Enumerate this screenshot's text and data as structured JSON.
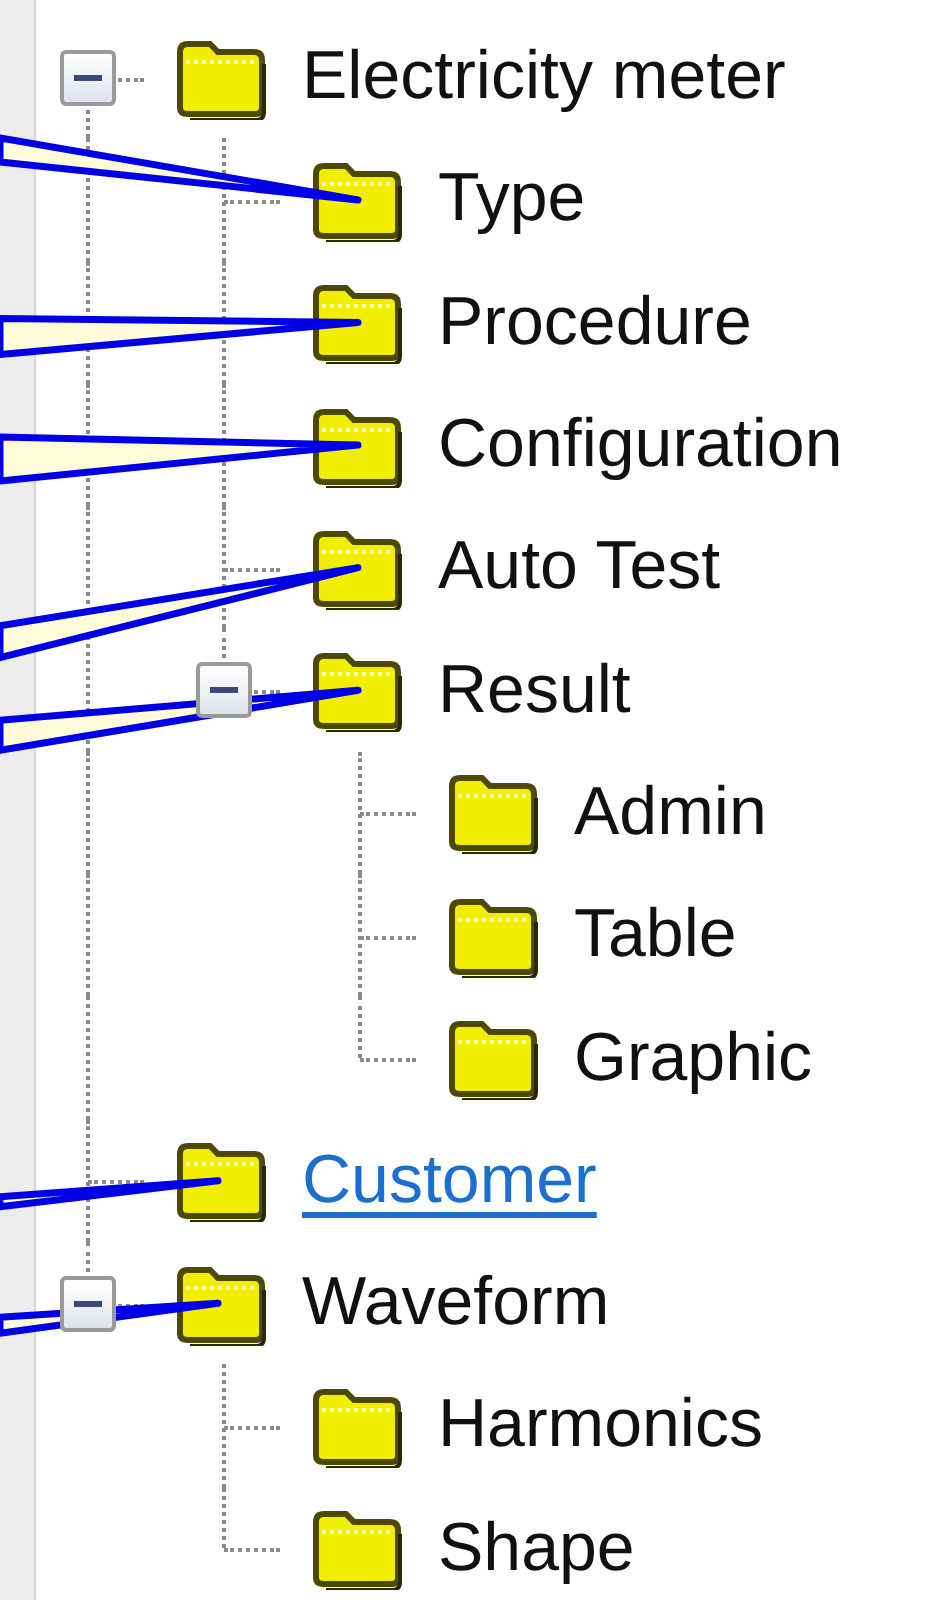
{
  "tree": [
    {
      "label": "Electricity meter",
      "expanded": true,
      "hovered": false,
      "callout": false,
      "children": [
        {
          "label": "Type",
          "hovered": false,
          "callout": true
        },
        {
          "label": "Procedure",
          "hovered": false,
          "callout": true
        },
        {
          "label": "Configuration",
          "hovered": false,
          "callout": true
        },
        {
          "label": "Auto Test",
          "hovered": false,
          "callout": true
        },
        {
          "label": "Result",
          "expanded": true,
          "hovered": false,
          "callout": true,
          "children": [
            {
              "label": "Admin",
              "hovered": false,
              "callout": false
            },
            {
              "label": "Table",
              "hovered": false,
              "callout": false
            },
            {
              "label": "Graphic",
              "hovered": false,
              "callout": false
            }
          ]
        }
      ]
    },
    {
      "label": "Customer",
      "hovered": true,
      "callout": true
    },
    {
      "label": "Waveform",
      "expanded": true,
      "hovered": false,
      "callout": true,
      "children": [
        {
          "label": "Harmonics",
          "hovered": false,
          "callout": false
        },
        {
          "label": "Shape",
          "hovered": false,
          "callout": false
        }
      ]
    }
  ]
}
